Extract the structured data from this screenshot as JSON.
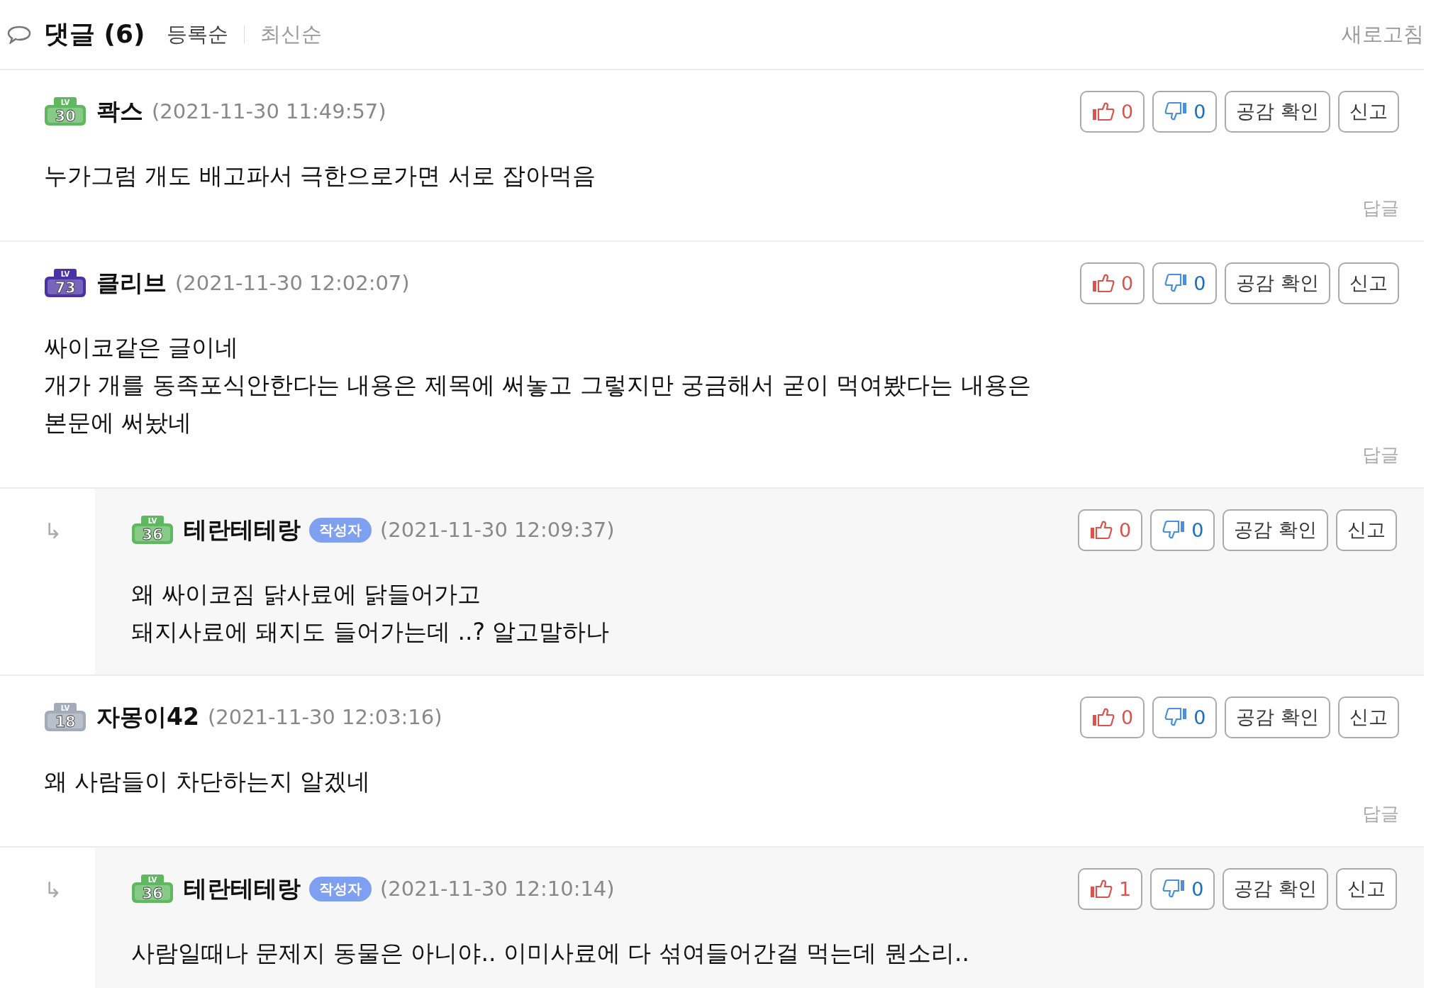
{
  "header": {
    "title": "댓글 (6)",
    "sort_tabs": [
      {
        "label": "등록순",
        "selected": true
      },
      {
        "label": "최신순",
        "selected": false
      }
    ],
    "refresh": "새로고침"
  },
  "comments": [
    {
      "badge": {
        "label": "LV",
        "number": "30",
        "color": "#5fb85f"
      },
      "author": "콱스",
      "date": "(2021-11-30 11:49:57)",
      "likes": "0",
      "dislikes": "0",
      "actions": [
        "공감 확인",
        "신고"
      ],
      "lines": [
        "누가그럼 개도 배고파서 극한으로가면 서로 잡아먹음"
      ],
      "reply_link": "답글"
    },
    {
      "badge": {
        "label": "LV",
        "number": "73",
        "color": "#4a32a6"
      },
      "author": "클리브",
      "date": "(2021-11-30 12:02:07)",
      "likes": "0",
      "dislikes": "0",
      "actions": [
        "공감 확인",
        "신고"
      ],
      "lines": [
        "싸이코같은 글이네",
        "개가 개를 동족포식안한다는 내용은 제목에 써놓고 그렇지만 궁금해서 굳이 먹여봤다는 내용은 본문에 써놨네"
      ],
      "reply_link": "답글",
      "children": [
        {
          "arrow": "↳",
          "badge": {
            "label": "LV",
            "number": "36",
            "color": "#5fb85f"
          },
          "author": "테란테테랑",
          "author_tag": "작성자",
          "date": "(2021-11-30 12:09:37)",
          "likes": "0",
          "dislikes": "0",
          "actions": [
            "공감 확인",
            "신고"
          ],
          "lines": [
            "왜 싸이코짐 닭사료에 닭들어가고",
            "돼지사료에 돼지도 들어가는데 ..? 알고말하나"
          ]
        }
      ]
    },
    {
      "badge": {
        "label": "LV",
        "number": "18",
        "color": "#a3abb8"
      },
      "author": "자몽이42",
      "date": "(2021-11-30 12:03:16)",
      "likes": "0",
      "dislikes": "0",
      "actions": [
        "공감 확인",
        "신고"
      ],
      "lines": [
        "왜 사람들이 차단하는지 알겠네"
      ],
      "reply_link": "답글",
      "children": [
        {
          "arrow": "↳",
          "badge": {
            "label": "LV",
            "number": "36",
            "color": "#5fb85f"
          },
          "author": "테란테테랑",
          "author_tag": "작성자",
          "date": "(2021-11-30 12:10:14)",
          "likes": "1",
          "dislikes": "0",
          "actions": [
            "공감 확인",
            "신고"
          ],
          "lines": [
            "사람일때나 문제지 동물은 아니야.. 이미사료에 다 섞여들어간걸 먹는데 뭔소리.."
          ]
        }
      ]
    }
  ]
}
